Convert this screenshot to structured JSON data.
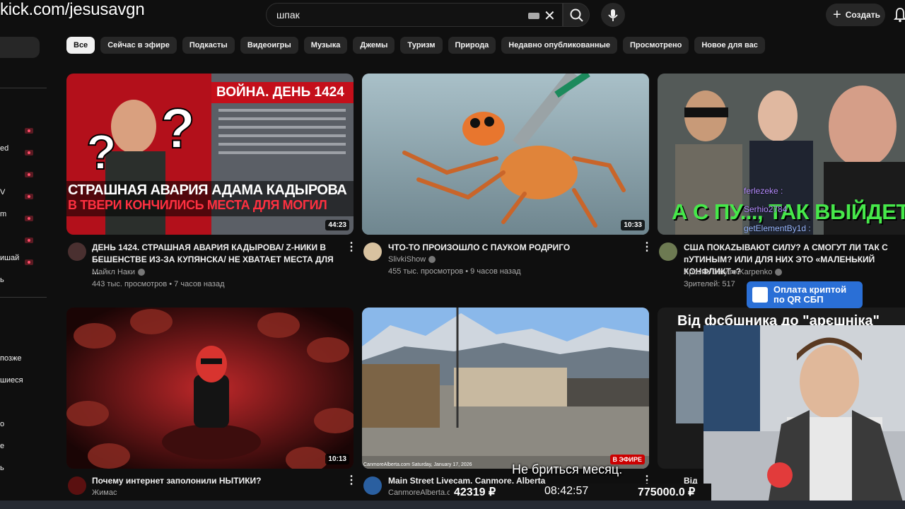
{
  "overlay": {
    "stream_url": "kick.com/jesusavgn",
    "subtitle": "Не бриться месяц.",
    "donate_left": "42319 ₽",
    "clock": "08:42:57",
    "donate_right": "775000.0 ₽",
    "qr_line1": "Оплата криптой",
    "qr_line2": "по QR СБП",
    "chat": [
      {
        "user": "ferlezeke :",
        "color": "#b58cff"
      },
      {
        "user": "Serhio2784",
        "color": "#b58cff"
      },
      {
        "user": "getElementBy1d :",
        "color": "#9ab8ff"
      }
    ]
  },
  "header": {
    "search_query": "шпак",
    "create_label": "Создать"
  },
  "sidebar": {
    "items": [
      "ed",
      "V",
      "m",
      "ишай",
      "ь",
      "позже",
      "шиеся",
      "о",
      "е",
      "ь"
    ]
  },
  "chips": [
    "Все",
    "Сейчас в эфире",
    "Подкасты",
    "Видеоигры",
    "Музыка",
    "Джемы",
    "Туризм",
    "Природа",
    "Недавно опубликованные",
    "Просмотрено",
    "Новое для вас"
  ],
  "videos": [
    {
      "title": "ДЕНЬ 1424. СТРАШНАЯ АВАРИЯ КАДЫРОВА/ Z-НИКИ В БЕШЕНСТВЕ ИЗ-ЗА КУПЯНСКА/ НЕ ХВАТАЕТ МЕСТА ДЛЯ ...",
      "channel": "Майкл Наки",
      "meta": "443 тыс. просмотров • 7 часов назад",
      "duration": "44:23",
      "thumb_banner": "ВОЙНА. ДЕНЬ 1424",
      "thumb_line1": "СТРАШНАЯ АВАРИЯ АДАМА КАДЫРОВА",
      "thumb_line2": "В ТВЕРИ КОНЧИЛИСЬ МЕСТА ДЛЯ МОГИЛ"
    },
    {
      "title": "ЧТО-ТО ПРОИЗОШЛО С ПАУКОМ РОДРИГО",
      "channel": "SlivkiShow",
      "meta": "455 тыс. просмотров • 9 часов назад",
      "duration": "10:33"
    },
    {
      "title": "США ПОКАZЫВАЮТ СИЛУ? А СМОГУТ ЛИ ТАК С пУТИНЫМ? ИЛИ ДЛЯ НИХ ЭТО «МАЛЕНЬКИЙ КОНФЛИКТ»?",
      "channel": "Apostle Dmytro Karpenko",
      "meta": "Зрителей: 517",
      "thumb_caption": "А С ПУ..., ТАК ВЫЙДЕТ"
    },
    {
      "title": "Почему интернет заполонили НЫТИКИ?",
      "channel": "Жимас",
      "duration": "10:13"
    },
    {
      "title": "Main Street Livecam, Canmore, Alberta",
      "channel": "CanmoreAlberta.com",
      "live": "В ЭФИРЕ",
      "cam_stamp": "CanmoreAlberta.com Saturday, January 17, 2026"
    },
    {
      "title": "Від",
      "thumb_caption": "Від фсбшника до \"арєшніка\""
    }
  ]
}
